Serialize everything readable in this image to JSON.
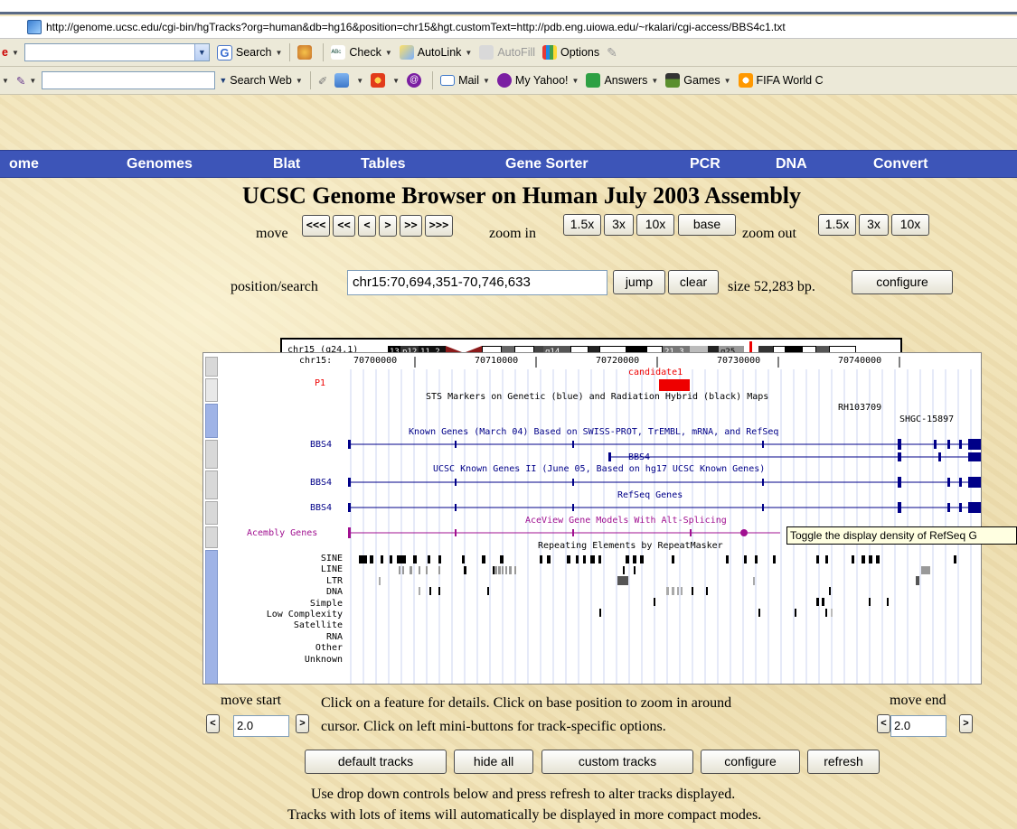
{
  "browser": {
    "address_url": "http://genome.ucsc.edu/cgi-bin/hgTracks?org=human&db=hg16&position=chr15&hgt.customText=http://pdb.eng.uiowa.edu/~rkalari/cgi-access/BBS4c1.txt",
    "toolbar1": {
      "left_fragment": "e",
      "search_label": "Search",
      "check_label": "Check",
      "autolink_label": "AutoLink",
      "autofill_label": "AutoFill",
      "options_label": "Options"
    },
    "toolbar2": {
      "search_web_label": "Search Web",
      "mail_label": "Mail",
      "my_yahoo_label": "My Yahoo!",
      "answers_label": "Answers",
      "games_label": "Games",
      "fifa_label": "FIFA World C"
    }
  },
  "nav": {
    "items": [
      "ome",
      "Genomes",
      "Blat",
      "Tables",
      "Gene Sorter",
      "PCR",
      "DNA",
      "Convert"
    ]
  },
  "header": {
    "title": "UCSC Genome Browser on Human July 2003 Assembly",
    "move_label": "move",
    "move_buttons": [
      "<<<",
      "<<",
      "<",
      ">",
      ">>",
      ">>>"
    ],
    "zoom_in_label": "zoom in",
    "zoom_in_buttons": [
      "1.5x",
      "3x",
      "10x",
      "base"
    ],
    "zoom_out_label": "zoom out",
    "zoom_out_buttons": [
      "1.5x",
      "3x",
      "10x"
    ]
  },
  "position": {
    "label": "position/search",
    "value": "chr15:70,694,351-70,746,633",
    "jump_label": "jump",
    "clear_label": "clear",
    "size_text": "size 52,283 bp.",
    "configure_label": "configure"
  },
  "ideogram": {
    "label": "chr15 (q24.1)",
    "band_labels": [
      "13",
      "p12",
      "11.2",
      "q14",
      "21.3",
      "q25"
    ]
  },
  "tracks": {
    "ruler_label": "chr15:",
    "ruler_ticks": [
      "70700000",
      "70710000",
      "70720000",
      "70730000",
      "70740000"
    ],
    "candidate_label": "candidate1",
    "p1_label": "P1",
    "sts_title": "STS Markers on Genetic (blue) and Radiation Hybrid (black) Maps",
    "sts_items": [
      "RH103709",
      "SHGC-15897"
    ],
    "known_genes_title": "Known Genes (March 04) Based on SWISS-PROT, TrEMBL, mRNA, and RefSeq",
    "known_genes_ii_title": "UCSC Known Genes II (June 05, Based on hg17 UCSC Known Genes)",
    "refseq_title": "RefSeq Genes",
    "aceview_title": "AceView Gene Models With Alt-Splicing",
    "repeat_title": "Repeating Elements by RepeatMasker",
    "gene_name": "BBS4",
    "acembly_label": "Acembly Genes",
    "repeat_classes": [
      "SINE",
      "LINE",
      "LTR",
      "DNA",
      "Simple",
      "Low Complexity",
      "Satellite",
      "RNA",
      "Other",
      "Unknown"
    ],
    "tooltip": "Toggle the display density of RefSeq G"
  },
  "bottom": {
    "move_start_label": "move start",
    "move_end_label": "move end",
    "start_value": "2.0",
    "end_value": "2.0",
    "instruction_line1": "Click on a feature for details. Click on base position to zoom in around",
    "instruction_line2": "cursor. Click on left mini-buttons for track-specific options.",
    "buttons": [
      "default tracks",
      "hide all",
      "custom tracks",
      "configure",
      "refresh"
    ],
    "note_line1": "Use drop down controls below and press refresh to alter tracks displayed.",
    "note_line2": "Tracks with lots of items will automatically be displayed in more compact modes."
  },
  "colors": {
    "nav_bg": "#3d55b8",
    "candidate": "#ff0000",
    "known_gene_blue": "#000088",
    "acembly_purple": "#a01090"
  }
}
